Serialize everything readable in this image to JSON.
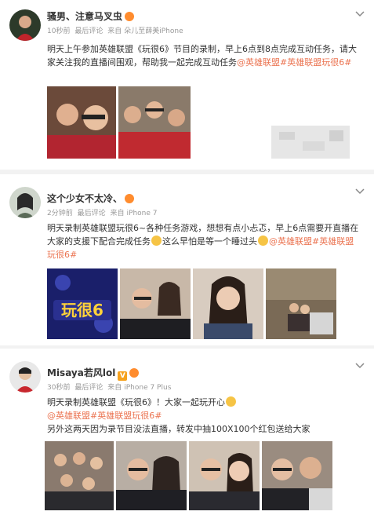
{
  "posts": [
    {
      "user_name": "骚男、注意马叉虫",
      "time": "10秒前",
      "recent": "最后评论",
      "source_prefix": "来自",
      "source": "朵儿至薛美iPhone",
      "text_main": "明天上午参加英雄联盟《玩很6》节目的录制，早上6点到8点完成互动任务，请大家关注我的直播间围观，帮助我一起完成互动任务",
      "tag1": "@英雄联盟",
      "tag2": "#英雄联盟玩很6#"
    },
    {
      "user_name": "这个少女不太冷、",
      "time": "2分钟前",
      "recent": "最后评论",
      "source_prefix": "来自",
      "source": "iPhone 7",
      "text_main": "明天录制英雄联盟玩很6~各种任务游戏，想想有点小忐忑，早上6点需要开直播在大家的支援下配合完成任务",
      "text_after_emoji": "这么早怕是等一个睡过头",
      "tag1": "@英雄联盟",
      "tag2": "#英雄联盟玩很6#",
      "show_logo_text": "玩很6"
    },
    {
      "user_name": "Misaya若风lol",
      "time": "30秒前",
      "recent": "最后评论",
      "source_prefix": "来自",
      "source": "iPhone 7 Plus",
      "text_line1": "明天录制英雄联盟《玩很6》！大家一起玩开心",
      "tag1": "@英雄联盟",
      "tag2": "#英雄联盟玩很6#",
      "text_line3": "另外这两天因为录节目没法直播，转发中抽100X100个红包送给大家"
    }
  ],
  "icons": {
    "chevron": "chevron-down-icon",
    "verified": "verified-v-icon",
    "crown": "vip-crown-icon",
    "emoji": "emoji-icon"
  },
  "colors": {
    "tag": "#eb7350",
    "meta": "#999999",
    "text": "#333333",
    "badge": "#f6a21e"
  }
}
